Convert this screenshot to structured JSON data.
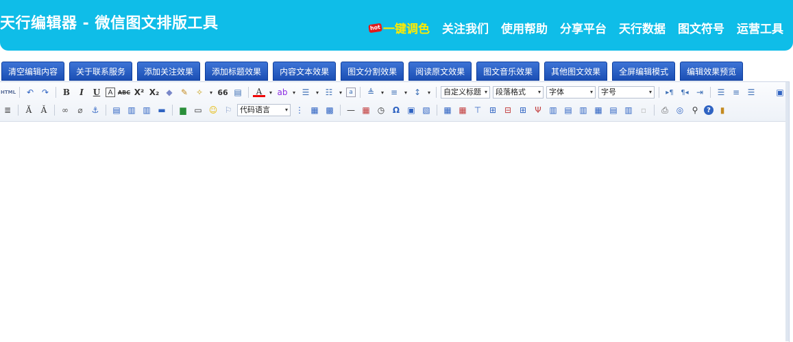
{
  "header": {
    "brand": "天行编辑器 - 微信图文排版工具",
    "hot_badge": "hot",
    "nav": [
      "一键调色",
      "关注我们",
      "使用帮助",
      "分享平台",
      "天行数据",
      "图文符号",
      "运营工具"
    ]
  },
  "tabs": [
    "清空编辑内容",
    "关于联系服务",
    "添加关注效果",
    "添加标题效果",
    "内容文本效果",
    "图文分割效果",
    "阅读原文效果",
    "图文音乐效果",
    "其他图文效果",
    "全屏编辑模式",
    "编辑效果预览"
  ],
  "toolbar": {
    "html_label": "HTML",
    "bold": "B",
    "italic": "I",
    "underline": "U",
    "quote": "66",
    "font_color": "A",
    "combos": {
      "custom_title": "自定义标题",
      "paragraph": "段落格式",
      "font": "字体",
      "font_size": "字号",
      "code_lang": "代码语言"
    },
    "omega": "Ω"
  },
  "colors": {
    "header_bg": "#0fbde8",
    "tab_bg": "#2a5fc4",
    "hot_nav": "#ffea00"
  }
}
